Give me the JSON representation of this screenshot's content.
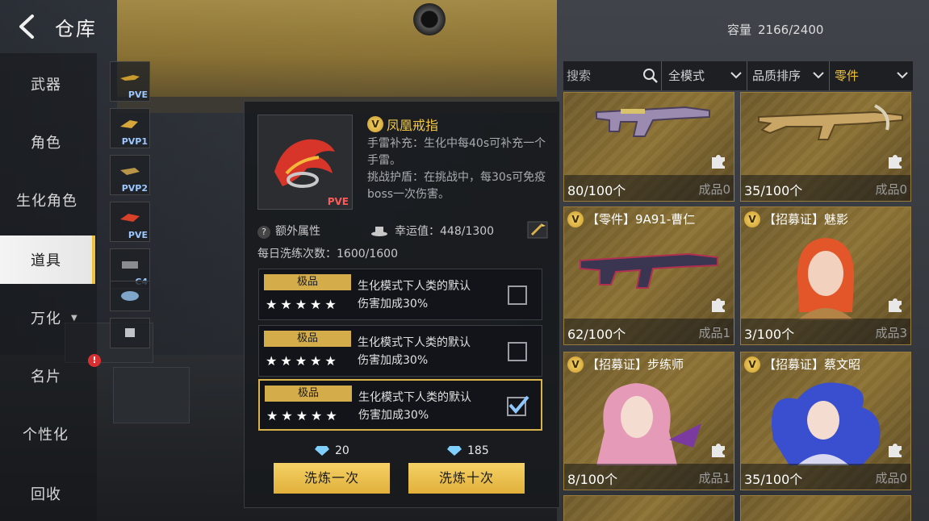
{
  "header": {
    "title": "仓库",
    "capacity_label": "容量",
    "capacity_value": "2166/2400"
  },
  "nav": {
    "items": [
      {
        "label": "武器"
      },
      {
        "label": "角色"
      },
      {
        "label": "生化角色"
      },
      {
        "label": "道具"
      },
      {
        "label": "万化"
      },
      {
        "label": "名片"
      },
      {
        "label": "个性化"
      },
      {
        "label": "回收"
      }
    ],
    "active": "道具"
  },
  "subitems": [
    {
      "tag": "PVE"
    },
    {
      "tag": "PVP1"
    },
    {
      "tag": "PVP2"
    },
    {
      "tag": "PVE"
    },
    {
      "tag": "C4"
    },
    {
      "tag": ""
    },
    {
      "tag": ""
    }
  ],
  "detail": {
    "thumb_tag": "PVE",
    "quality_icon": "V",
    "name": "凤凰戒指",
    "desc_1": "手雷补充：生化中每40s可补充一个手雷。",
    "desc_2": "挑战护盾：在挑战中，每30s可免疫boss一次伤害。",
    "extra_attr_label": "额外属性",
    "luck_label": "幸运值：448/1300",
    "daily_wash_label": "每日洗练次数：1600/1600",
    "rolls": [
      {
        "grade": "极品",
        "stars": "★★★★★",
        "text_1": "生化模式下人类的默认",
        "text_2": "伤害加成30%",
        "selected": false
      },
      {
        "grade": "极品",
        "stars": "★★★★★",
        "text_1": "生化模式下人类的默认",
        "text_2": "伤害加成30%",
        "selected": false
      },
      {
        "grade": "极品",
        "stars": "★★★★★",
        "text_1": "生化模式下人类的默认",
        "text_2": "伤害加成30%",
        "selected": true
      }
    ],
    "cost_once": "20",
    "cost_ten": "185",
    "btn_once": "洗炼一次",
    "btn_ten": "洗炼十次"
  },
  "filters": {
    "search_placeholder": "搜索",
    "mode": "全模式",
    "sort": "品质排序",
    "category": "零件"
  },
  "cards": [
    {
      "title": "",
      "count": "80/100个",
      "finished": "成品0",
      "art": "gun"
    },
    {
      "title": "",
      "count": "35/100个",
      "finished": "成品0",
      "art": "gun"
    },
    {
      "title": "【零件】9A91-曹仁",
      "count": "62/100个",
      "finished": "成品1",
      "art": "gun"
    },
    {
      "title": "【招募证】魅影",
      "count": "3/100个",
      "finished": "成品3",
      "art": "girl-orange"
    },
    {
      "title": "【招募证】步练师",
      "count": "8/100个",
      "finished": "成品1",
      "art": "girl-pink"
    },
    {
      "title": "【招募证】蔡文昭",
      "count": "35/100个",
      "finished": "成品0",
      "art": "girl-blue"
    }
  ],
  "colors": {
    "accent": "#f0c23a",
    "card_gold": "#8d7335",
    "selected_border": "#d9b24a"
  }
}
